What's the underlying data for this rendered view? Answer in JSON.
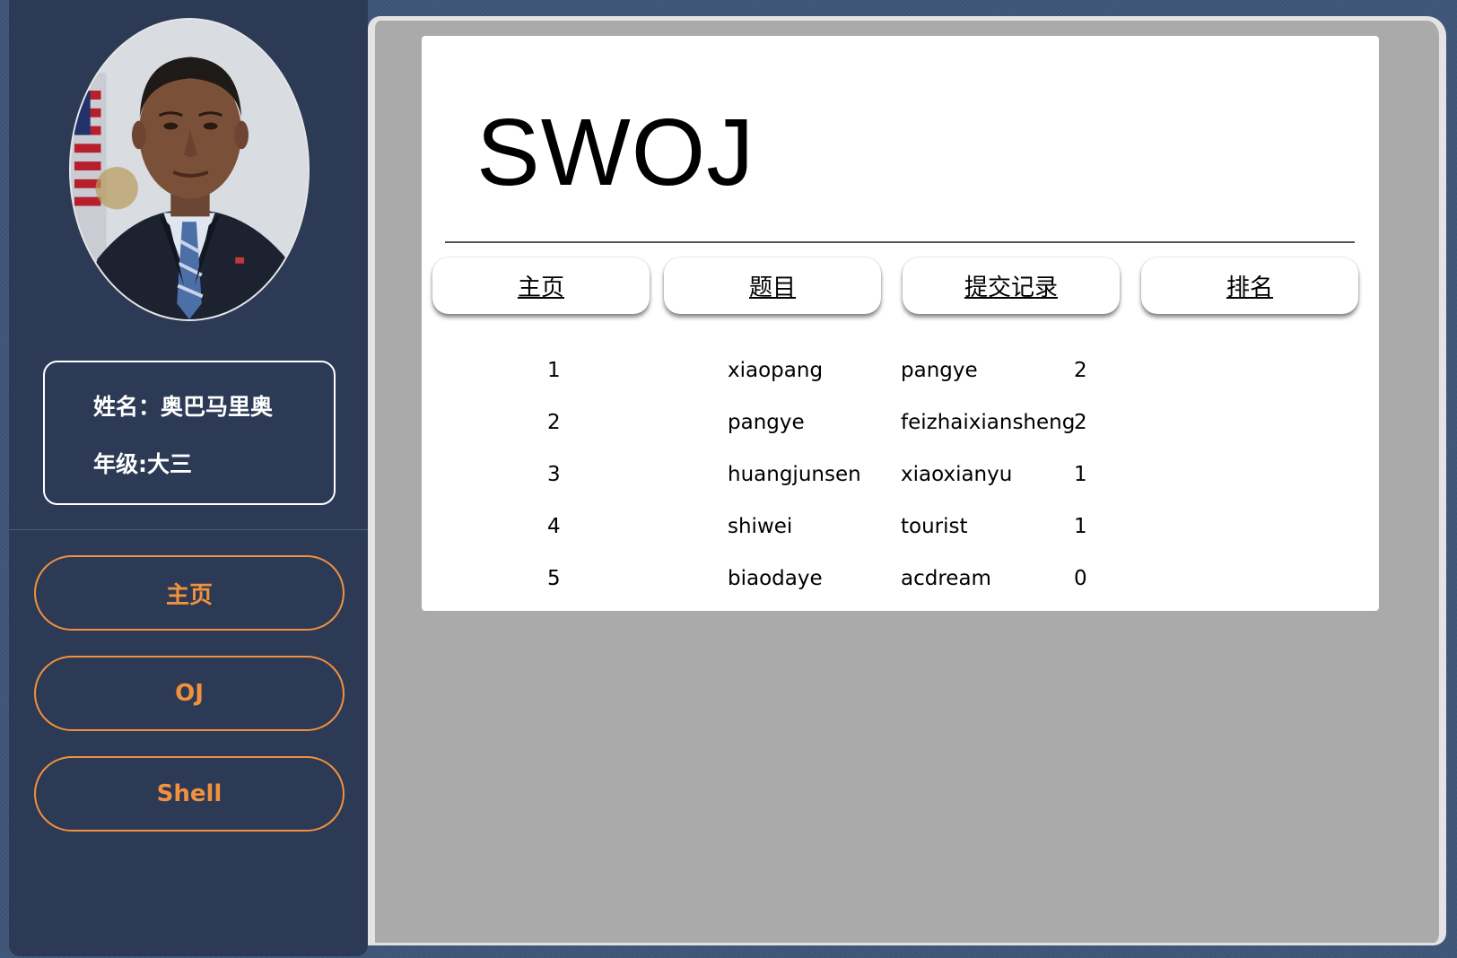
{
  "sidebar": {
    "profile": {
      "name_line": "姓名：奥巴马里奥",
      "grade_line": "年级:大三"
    },
    "buttons": [
      {
        "label": "主页"
      },
      {
        "label": "OJ"
      },
      {
        "label": "Shell"
      }
    ]
  },
  "main": {
    "title": "SWOJ",
    "tabs": [
      {
        "label": "主页"
      },
      {
        "label": "题目"
      },
      {
        "label": "提交记录"
      },
      {
        "label": "排名"
      }
    ],
    "ranking": [
      {
        "rank": "1",
        "user": "xiaopang",
        "second": "pangye",
        "count": "2"
      },
      {
        "rank": "2",
        "user": "pangye",
        "second": "feizhaixiansheng",
        "count": "2"
      },
      {
        "rank": "3",
        "user": "huangjunsen",
        "second": "xiaoxianyu",
        "count": "1"
      },
      {
        "rank": "4",
        "user": "shiwei",
        "second": "tourist",
        "count": "1"
      },
      {
        "rank": "5",
        "user": "biaodaye",
        "second": "acdream",
        "count": "0"
      }
    ]
  },
  "colors": {
    "sidebar_bg": "#2c3a55",
    "accent": "#f2913d",
    "panel_bg": "#aaaaaa",
    "card_bg": "#ffffff"
  }
}
